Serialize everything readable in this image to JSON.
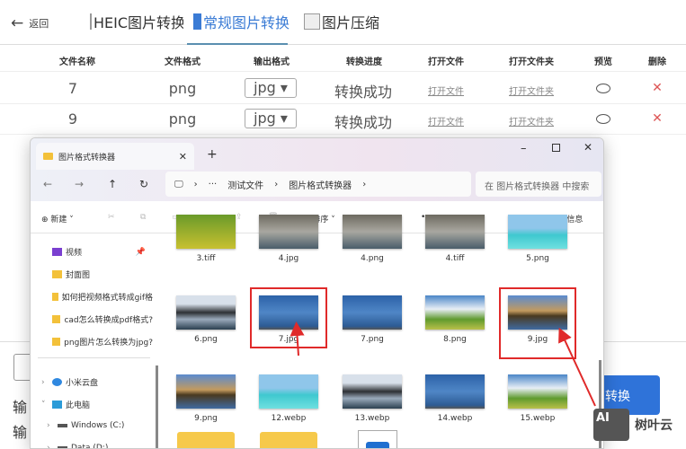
{
  "header": {
    "back": "返回",
    "tabs": [
      {
        "label": "HEIC图片转换"
      },
      {
        "label": "常规图片转换",
        "active": true
      },
      {
        "label": "图片压缩"
      }
    ]
  },
  "table": {
    "columns": [
      "文件名称",
      "文件格式",
      "输出格式",
      "转换进度",
      "打开文件",
      "打开文件夹",
      "预览",
      "删除"
    ],
    "rows": [
      {
        "name": "7",
        "format": "png",
        "output": "jpg",
        "status": "转换成功",
        "open": "打开文件",
        "folder": "打开文件夹"
      },
      {
        "name": "9",
        "format": "png",
        "output": "jpg",
        "status": "转换成功",
        "open": "打开文件",
        "folder": "打开文件夹"
      }
    ]
  },
  "background": {
    "label1": "输",
    "label2": "输",
    "convert": "转换"
  },
  "explorer": {
    "tab_title": "图片格式转换器",
    "path": [
      "测试文件",
      "图片格式转换器"
    ],
    "search_placeholder": "在 图片格式转换器 中搜索",
    "toolbar": {
      "new": "新建",
      "sort": "排序",
      "view": "查看",
      "more": "•••",
      "details": "详细信息"
    },
    "sidebar": [
      {
        "label": "视频",
        "icon": "video-icon"
      },
      {
        "label": "封面图",
        "icon": "folder-icon"
      },
      {
        "label": "如何把视频格式转成gif格",
        "icon": "folder-icon"
      },
      {
        "label": "cad怎么转换成pdf格式?",
        "icon": "folder-icon"
      },
      {
        "label": "png图片怎么转换为jpg?",
        "icon": "folder-icon"
      },
      {
        "label": "小米云盘",
        "icon": "cloud-icon"
      },
      {
        "label": "此电脑",
        "icon": "pc-icon"
      },
      {
        "label": "Windows (C:)",
        "icon": "drive-icon"
      },
      {
        "label": "Data (D:)",
        "icon": "drive-icon"
      }
    ],
    "files": [
      {
        "name": "3.tiff",
        "thumb": "flowers"
      },
      {
        "name": "4.jpg",
        "thumb": "rocks"
      },
      {
        "name": "4.png",
        "thumb": "rocks"
      },
      {
        "name": "4.tiff",
        "thumb": "rocks"
      },
      {
        "name": "5.png",
        "thumb": "sea"
      },
      {
        "name": "6.png",
        "thumb": "lake"
      },
      {
        "name": "7.jpg",
        "thumb": "blue-mountain",
        "highlight": "red-box"
      },
      {
        "name": "7.png",
        "thumb": "blue-mountain",
        "selected": true
      },
      {
        "name": "8.png",
        "thumb": "tree"
      },
      {
        "name": "9.jpg",
        "thumb": "golden-lake",
        "highlight": "red-box"
      },
      {
        "name": "9.png",
        "thumb": "golden-lake"
      },
      {
        "name": "12.webp",
        "thumb": "sea"
      },
      {
        "name": "13.webp",
        "thumb": "lake"
      },
      {
        "name": "14.webp",
        "thumb": "blue-mountain"
      },
      {
        "name": "15.webp",
        "thumb": "tree"
      }
    ]
  },
  "watermark": {
    "logo": "AI",
    "text": "树叶云"
  },
  "colors": {
    "accent": "#3a7bd5",
    "delete": "#dd5555",
    "annotation": "#e02a2a"
  }
}
